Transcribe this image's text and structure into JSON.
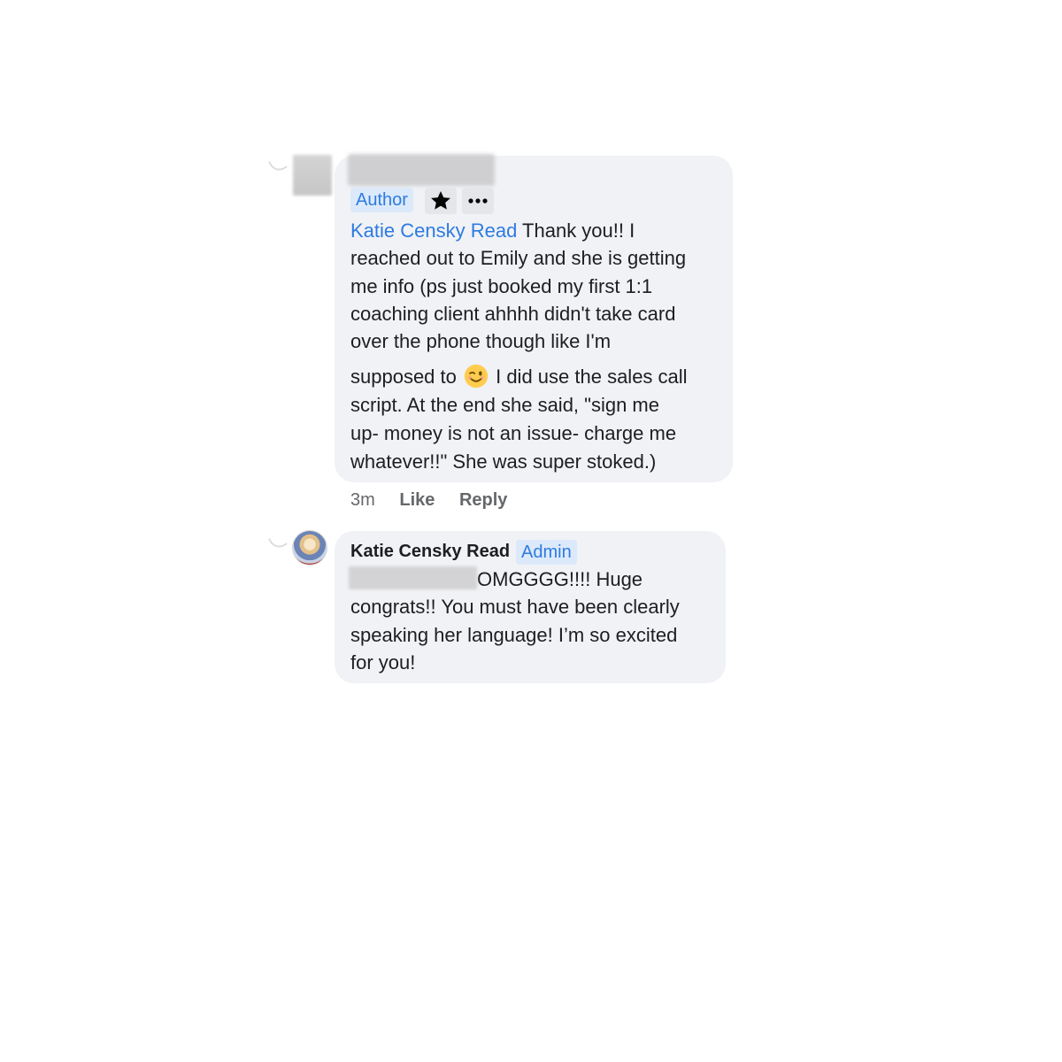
{
  "comment1": {
    "badge": "Author",
    "icons": [
      "star-icon",
      "more-icon"
    ],
    "mention": "Katie Censky Read",
    "text_lines_1": [
      " Thank you!! I",
      "reached out to Emily and she is getting",
      "me info (ps just booked my first 1:1",
      "coaching client ahhhh didn't take card",
      "over the phone though like I'm"
    ],
    "text_before_emoji": "supposed to ",
    "emoji": "winking-face-emoji",
    "text_after_emoji": " I did use the sales call",
    "text_lines_2": [
      "script. At the end she said, \"sign me",
      "up- money is not an issue- charge me",
      "whatever!!\" She was super stoked.)"
    ],
    "actions": {
      "time": "3m",
      "like": "Like",
      "reply": "Reply"
    }
  },
  "comment2": {
    "name": "Katie Censky Read",
    "badge": "Admin",
    "first_line_text": "OMGGGG!!!! Huge",
    "text_lines": [
      "congrats!! You must have been clearly",
      "speaking her language! I’m so excited",
      "for you!"
    ]
  }
}
